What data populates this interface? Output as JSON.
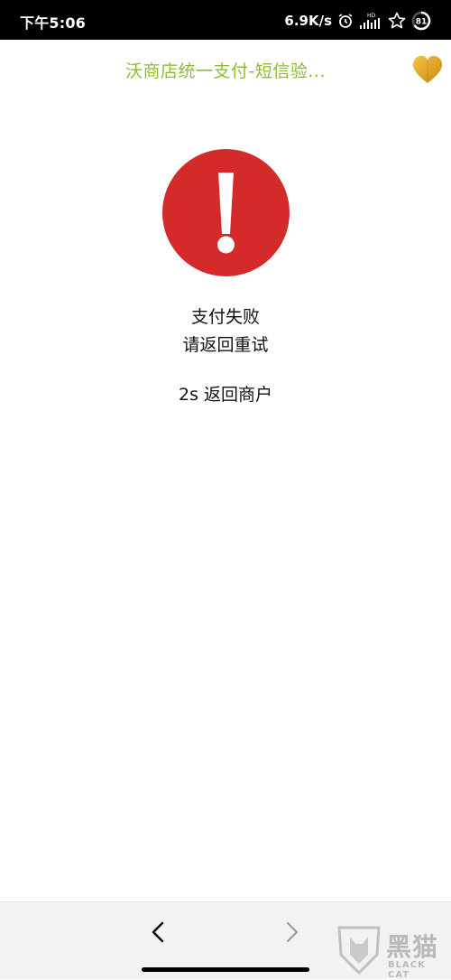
{
  "status_bar": {
    "time": "下午5:06",
    "net_speed": "6.9K/s",
    "signal_hd_label": "HD",
    "battery_level": "81"
  },
  "header": {
    "title": "沃商店统一支付-短信验...",
    "heart_icon": "heart-icon"
  },
  "result": {
    "icon": "alert-exclamation-icon",
    "status_text": "支付失败",
    "hint_text": "请返回重试",
    "countdown_text": "2s 返回商户"
  },
  "bottom_nav": {
    "back_icon": "chevron-left-icon",
    "forward_icon": "chevron-right-icon"
  },
  "watermark": {
    "cn_text": "黑猫",
    "en_text": "BLACK CAT"
  },
  "colors": {
    "title": "#8dbd2f",
    "alert": "#d42a2a",
    "heart": "#e3a72a",
    "status_bar": "#000000",
    "bottom_bar": "#f2f2f2"
  }
}
